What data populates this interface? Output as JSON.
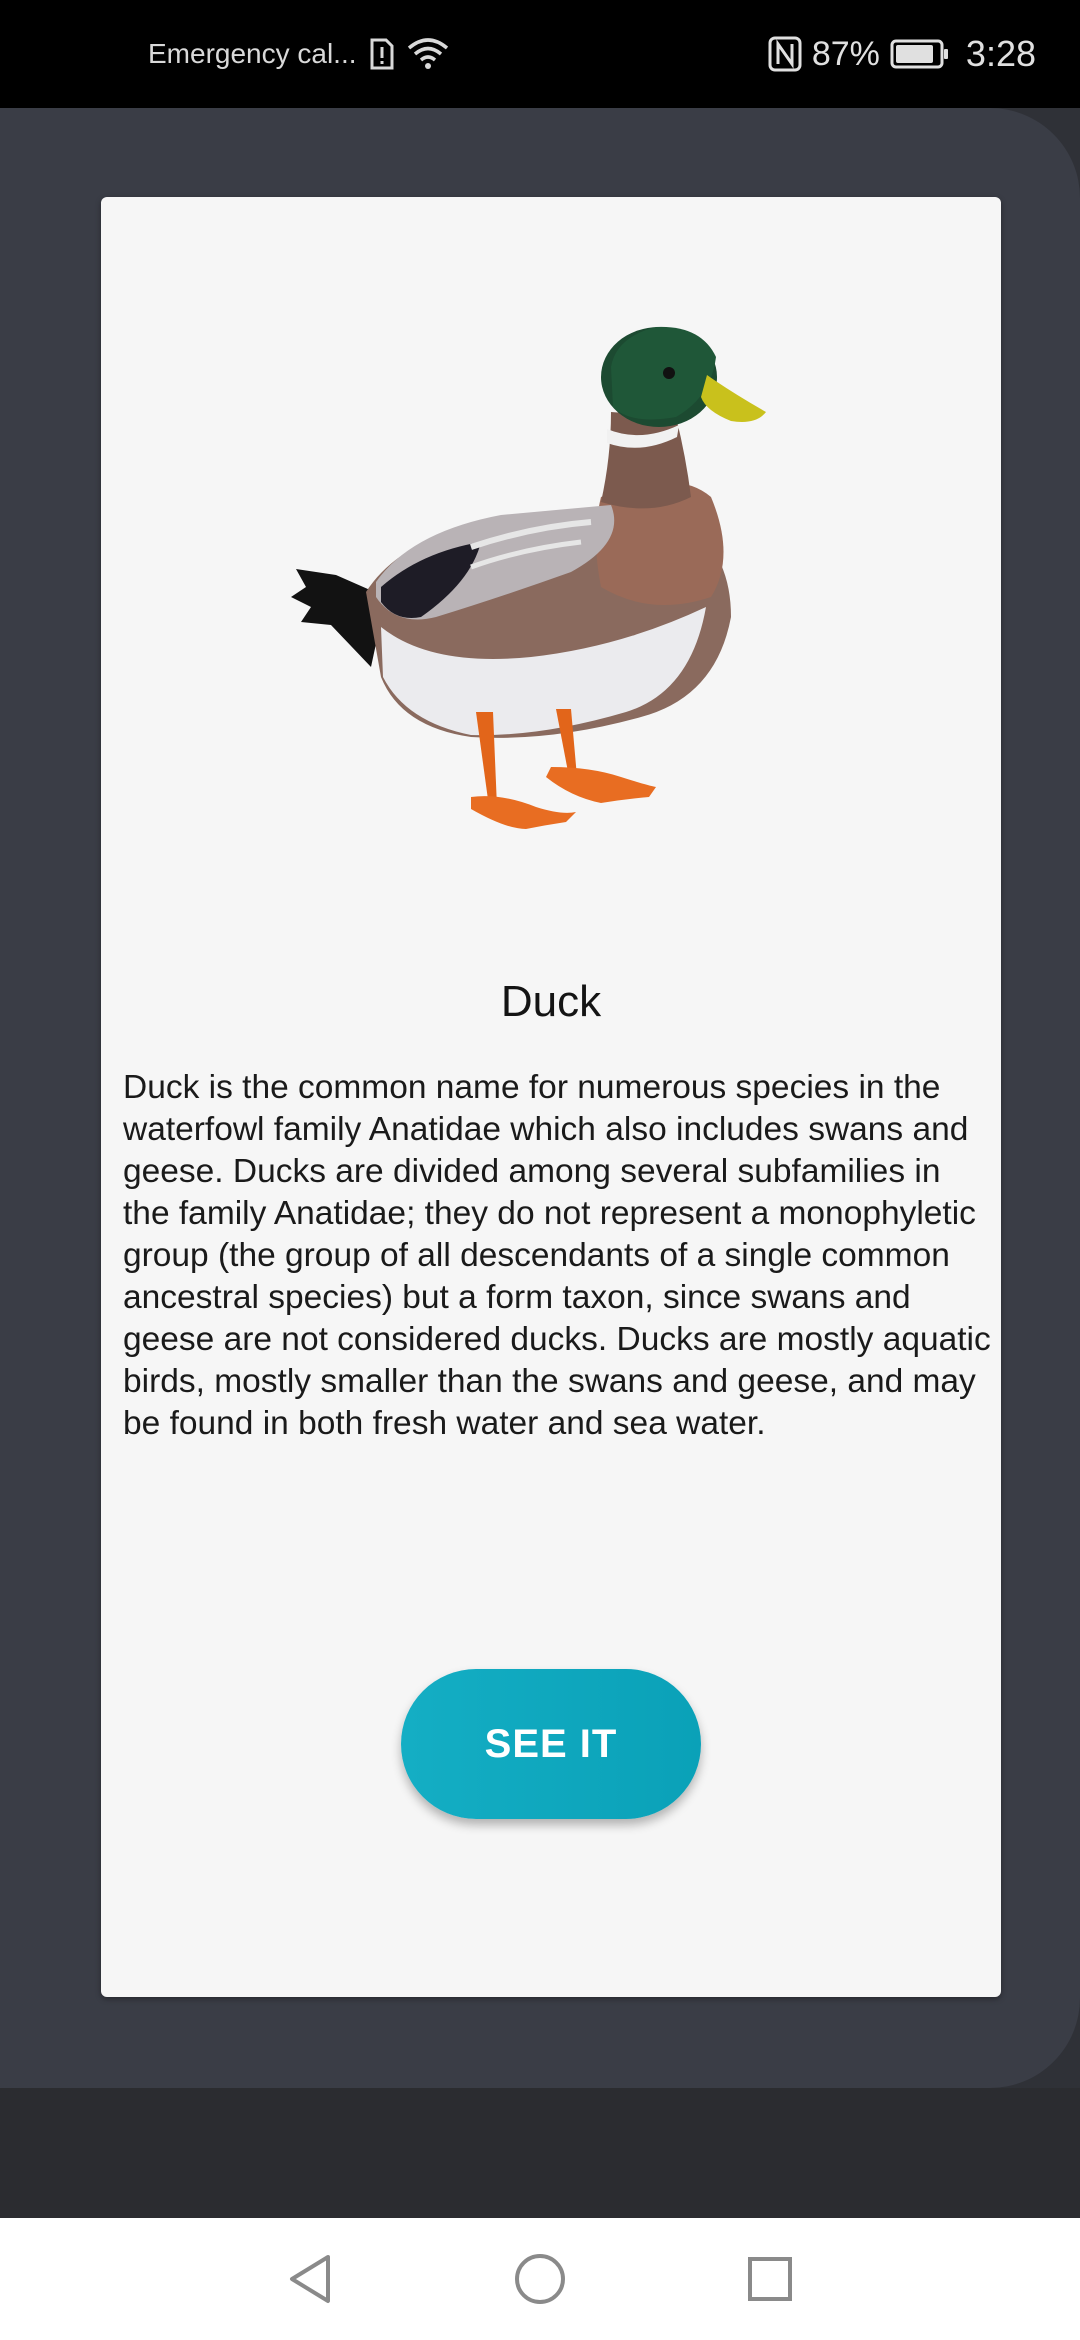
{
  "status_bar": {
    "carrier": "Emergency cal...",
    "battery": "87%",
    "time": "3:28",
    "icons": [
      "sim-alert-icon",
      "wifi-icon",
      "nfc-icon",
      "battery-icon"
    ]
  },
  "card": {
    "image_icon": "duck-image",
    "title": "Duck",
    "description": "Duck is the common name for numerous species in the waterfowl family Anatidae which also includes swans and geese. Ducks are divided among several subfamilies in the family Anatidae; they do not represent a monophyletic group (the group of all descendants of a single common ancestral species) but a form taxon, since swans and geese are not considered ducks. Ducks are mostly aquatic birds, mostly smaller than the swans and geese, and may be found in both fresh water and sea water.",
    "button_label": "SEE IT",
    "button_color": "#0fa8bf"
  },
  "nav_bar": {
    "icons": [
      "back-icon",
      "home-icon",
      "recents-icon"
    ]
  }
}
